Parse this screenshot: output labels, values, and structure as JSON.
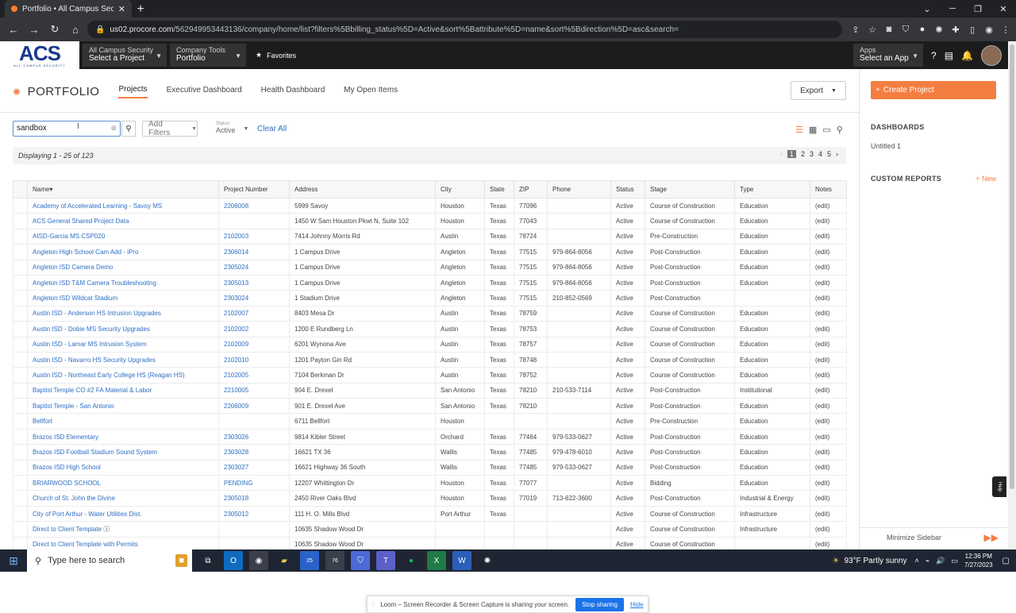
{
  "browser": {
    "tab_title": "Portfolio • All Campus Security",
    "url_host": "us02.procore.com",
    "url_path": "/562949953443136/company/home/list?filters%5Bbilling_status%5D=Active&sort%5Battribute%5D=name&sort%5Bdirection%5D=asc&search="
  },
  "header": {
    "logo_text": "ACS",
    "logo_sub": "ALL CAMPUS SECURITY",
    "project_picker": {
      "line1": "All Campus Security",
      "line2": "Select a Project"
    },
    "tools_picker": {
      "line1": "Company Tools",
      "line2": "Portfolio"
    },
    "favorites": "Favorites",
    "apps": {
      "line1": "Apps",
      "line2": "Select an App"
    }
  },
  "page": {
    "title": "PORTFOLIO",
    "tabs": [
      "Projects",
      "Executive Dashboard",
      "Health Dashboard",
      "My Open Items"
    ],
    "export": "Export",
    "search_value": "sandbox",
    "add_filters": "Add Filters",
    "status_label": "Status:",
    "status_value": "Active",
    "clear_all": "Clear All",
    "displaying": "Displaying 1 - 25 of 123",
    "pages": [
      "1",
      "2",
      "3",
      "4",
      "5"
    ]
  },
  "table": {
    "columns": [
      "Name▾",
      "Project Number",
      "Address",
      "City",
      "State",
      "ZIP",
      "Phone",
      "Status",
      "Stage",
      "Type",
      "Notes"
    ],
    "rows": [
      [
        "Academy of Accelerated Learning - Savoy MS",
        "2206008",
        "5999 Savoy",
        "Houston",
        "Texas",
        "77096",
        "",
        "Active",
        "Course of Construction",
        "Education",
        "(edit)"
      ],
      [
        "ACS General Shared Project Data",
        "",
        "1450 W Sam Houston Pkwt N, Suite 102",
        "Houston",
        "Texas",
        "77043",
        "",
        "Active",
        "Course of Construction",
        "Education",
        "(edit)"
      ],
      [
        "AISD-Garcia MS CSP020",
        "2102003",
        "7414 Johnny Morris Rd",
        "Austin",
        "Texas",
        "78724",
        "",
        "Active",
        "Pre-Construction",
        "Education",
        "(edit)"
      ],
      [
        "Angleton High School Cam Add - iPro",
        "2306014",
        "1 Campus Drive",
        "Angleton",
        "Texas",
        "77515",
        "979-864-8056",
        "Active",
        "Post-Construction",
        "Education",
        "(edit)"
      ],
      [
        "Angleton ISD Camera Demo",
        "2305024",
        "1 Campus Drive",
        "Angleton",
        "Texas",
        "77515",
        "979-864-8056",
        "Active",
        "Post-Construction",
        "Education",
        "(edit)"
      ],
      [
        "Angleton ISD T&M Camera Troubleshooting",
        "2305013",
        "1 Campus Drive",
        "Angleton",
        "Texas",
        "77515",
        "979-864-8056",
        "Active",
        "Post-Construction",
        "Education",
        "(edit)"
      ],
      [
        "Angleton ISD Wildcat Stadium",
        "2303024",
        "1 Stadium Drive",
        "Angleton",
        "Texas",
        "77515",
        "210-852-0569",
        "Active",
        "Post-Construction",
        "",
        "(edit)"
      ],
      [
        "Austin ISD - Anderson HS Intrusion Upgrades",
        "2102007",
        "8403 Mesa Dr",
        "Austin",
        "Texas",
        "78759",
        "",
        "Active",
        "Course of Construction",
        "Education",
        "(edit)"
      ],
      [
        "Austin ISD - Dobie MS Security Upgrades",
        "2102002",
        "1200 E Rundberg Ln",
        "Austin",
        "Texas",
        "78753",
        "",
        "Active",
        "Course of Construction",
        "Education",
        "(edit)"
      ],
      [
        "Austin ISD - Lamar MS Intrusion System",
        "2102009",
        "6201 Wynona Ave",
        "Austin",
        "Texas",
        "78757",
        "",
        "Active",
        "Course of Construction",
        "Education",
        "(edit)"
      ],
      [
        "Austin ISD - Navarro HS Security Upgrades",
        "2102010",
        "1201 Payton Gin Rd",
        "Austin",
        "Texas",
        "78748",
        "",
        "Active",
        "Course of Construction",
        "Education",
        "(edit)"
      ],
      [
        "Austin ISD - Northeast Early College HS (Reagan HS)",
        "2102005",
        "7104 Berkman Dr",
        "Austin",
        "Texas",
        "78752",
        "",
        "Active",
        "Course of Construction",
        "Education",
        "(edit)"
      ],
      [
        "Baptist Temple CO #2 FA Material & Labor",
        "2210005",
        "904 E. Drexel",
        "San Antonio",
        "Texas",
        "78210",
        "210-533-7114",
        "Active",
        "Post-Construction",
        "Institutional",
        "(edit)"
      ],
      [
        "Baptist Temple - San Antonio",
        "2206009",
        "901 E. Drexel Ave",
        "San Antonio",
        "Texas",
        "78210",
        "",
        "Active",
        "Post-Construction",
        "Education",
        "(edit)"
      ],
      [
        "Bellfort",
        "",
        "6711 Bellfort",
        "Houston",
        "",
        "",
        "",
        "Active",
        "Pre-Construction",
        "Education",
        "(edit)"
      ],
      [
        "Brazos ISD Elementary",
        "2303026",
        "9814 Kibler Street",
        "Orchard",
        "Texas",
        "77464",
        "979-533-0627",
        "Active",
        "Post-Construction",
        "Education",
        "(edit)"
      ],
      [
        "Brazos ISD Football Stadium Sound System",
        "2303028",
        "16621 TX 36",
        "Wallis",
        "Texas",
        "77485",
        "979-478-6010",
        "Active",
        "Post-Construction",
        "Education",
        "(edit)"
      ],
      [
        "Brazos ISD High School",
        "2303027",
        "16621 Highway 36 South",
        "Wallis",
        "Texas",
        "77485",
        "979-533-0627",
        "Active",
        "Post-Construction",
        "Education",
        "(edit)"
      ],
      [
        "BRIARWOOD SCHOOL",
        "PENDING",
        "12207 Whittington Dr",
        "Houston",
        "Texas",
        "77077",
        "",
        "Active",
        "Bidding",
        "Education",
        "(edit)"
      ],
      [
        "Church of St. John the Divine",
        "2305018",
        "2450 River Oaks Blvd",
        "Houston",
        "Texas",
        "77019",
        "713-622-3600",
        "Active",
        "Post-Construction",
        "Industrial & Energy",
        "(edit)"
      ],
      [
        "City of Port Arthur - Water Utilities Dist.",
        "2305012",
        "111 H. O. Mills Blvd",
        "Port Arthur",
        "Texas",
        "",
        "",
        "Active",
        "Course of Construction",
        "Infrastructure",
        "(edit)"
      ],
      [
        "Direct to Client Template",
        "",
        "10635 Shadow Wood Dr",
        "",
        "",
        "",
        "",
        "Active",
        "Course of Construction",
        "Infrastructure",
        "(edit)"
      ],
      [
        "Direct to Client Template with Permits",
        "",
        "10635 Shadow Wood Dr",
        "",
        "",
        "",
        "",
        "Active",
        "Course of Construction",
        "",
        "(edit)"
      ]
    ]
  },
  "loom": {
    "message": "Loom – Screen Recorder & Screen Capture is sharing your screen.",
    "stop": "Stop sharing",
    "hide": "Hide"
  },
  "sidebar": {
    "create": "Create Project",
    "dashboards": "DASHBOARDS",
    "untitled": "Untitled 1",
    "custom_reports": "CUSTOM REPORTS",
    "new": "+ New",
    "minimize": "Minimize Sidebar",
    "help": "Help"
  },
  "taskbar": {
    "search": "Type here to search",
    "badge_25": "25",
    "badge_76": "76",
    "weather": "93°F  Partly sunny",
    "time": "12:36 PM",
    "date": "7/27/2023"
  },
  "colors": {
    "accent": "#f47e42",
    "link": "#2f6fc3",
    "header": "#1c1c1c"
  }
}
